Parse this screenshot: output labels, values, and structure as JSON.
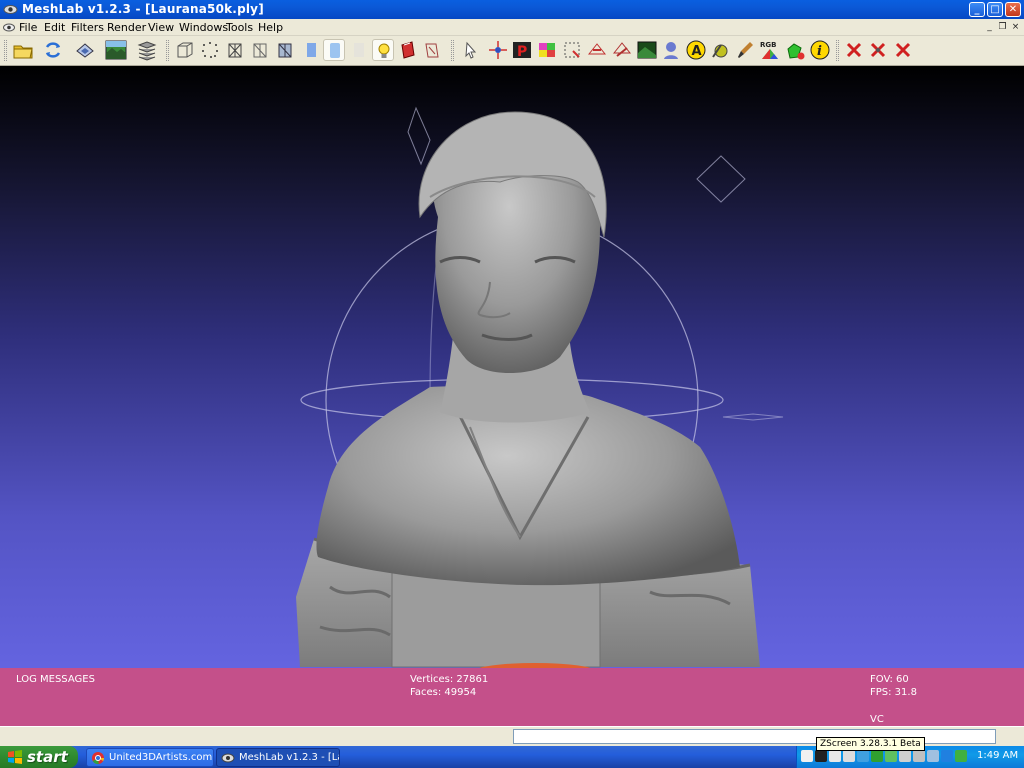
{
  "window": {
    "title": "MeshLab v1.2.3 - [Laurana50k.ply]",
    "minimize_label": "_",
    "maximize_label": "□",
    "close_label": "✕"
  },
  "menu": {
    "items": [
      "File",
      "Edit",
      "Filters",
      "Render",
      "View",
      "Windows",
      "Tools",
      "Help"
    ],
    "mdi_min": "_",
    "mdi_restore": "❐",
    "mdi_close": "×"
  },
  "toolbar": {
    "icons": [
      "open-folder-icon",
      "reload-icon",
      "save-layer-icon",
      "snapshot-icon",
      "layers-icon",
      "bounding-box-icon",
      "points-icon",
      "wireframe-icon",
      "hidden-lines-icon",
      "flat-lines-icon",
      "flat-icon",
      "smooth-icon",
      "texture-icon",
      "light-icon",
      "double-side-lighting-icon",
      "backface-icon",
      "select-faces-icon",
      "pick-point-icon",
      "paint-p-icon",
      "color-paint-icon",
      "select-vertex-icon",
      "measure-icon",
      "align-icon",
      "raster-icon",
      "point-cloud-icon",
      "annotate-a-icon",
      "z-paint-icon",
      "brush-icon",
      "rgb-icon",
      "stats-icon",
      "info-icon",
      "delete-faces-icon",
      "delete-vertices-icon",
      "delete-all-icon"
    ],
    "rgb_label": "RGB",
    "paint_p_label": "P",
    "annotate_label": "A",
    "info_label": "i"
  },
  "log": {
    "title": "LOG MESSAGES",
    "vertices": "Vertices: 27861",
    "faces": "Faces: 49954",
    "fov": "FOV: 60",
    "fps": "FPS:   31.8",
    "vc": "VC"
  },
  "taskbar": {
    "start_label": "start",
    "tasks": [
      {
        "label": "United3DArtists.com ...",
        "icon": "chrome-icon",
        "active": false
      },
      {
        "label": "MeshLab v1.2.3 - [La...",
        "icon": "meshlab-icon",
        "active": true
      }
    ],
    "clock": "1:49 AM",
    "tooltip": "ZScreen 3.28.3.1 Beta",
    "tray_icons": [
      "volume-icon",
      "zscreen-icon",
      "network-icon",
      "z-icon",
      "sync-icon",
      "download-icon",
      "shield-icon",
      "folder-icon",
      "lan-icon",
      "usb-icon",
      "antivirus-icon",
      "messenger-icon",
      "clock-icon",
      "eject-icon",
      "power-icon"
    ]
  },
  "colors": {
    "log_panel": "#c4508a",
    "viewport_top": "#000000",
    "viewport_bottom": "#6464e0",
    "title_blue": "#0a5fe0"
  }
}
